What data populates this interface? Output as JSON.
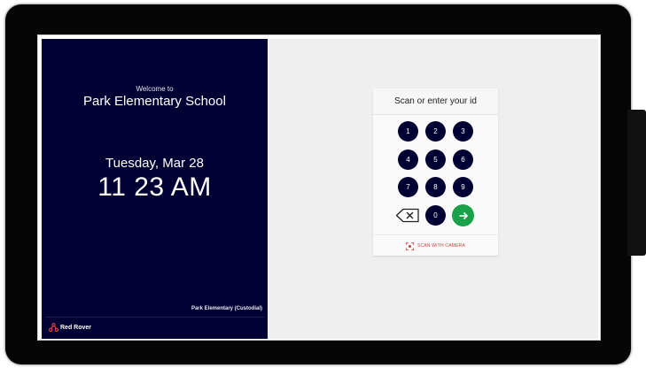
{
  "left_panel": {
    "welcome": "Welcome to",
    "school_name": "Park Elementary School",
    "date": "Tuesday, Mar 28",
    "time": "11 23 AM",
    "location": "Park Elementary (Custodial)",
    "brand_name": "Red Rover",
    "brand_color": "#e04848",
    "background_color": "#000033"
  },
  "keypad": {
    "title": "Scan or enter your id",
    "keys": [
      "1",
      "2",
      "3",
      "4",
      "5",
      "6",
      "7",
      "8",
      "9",
      "0"
    ],
    "backspace_icon": "backspace-icon",
    "submit_icon": "arrow-right-icon",
    "submit_color": "#1aa24a",
    "scan_label": "SCAN WITH CAMERA",
    "scan_icon": "camera-scan-icon"
  }
}
